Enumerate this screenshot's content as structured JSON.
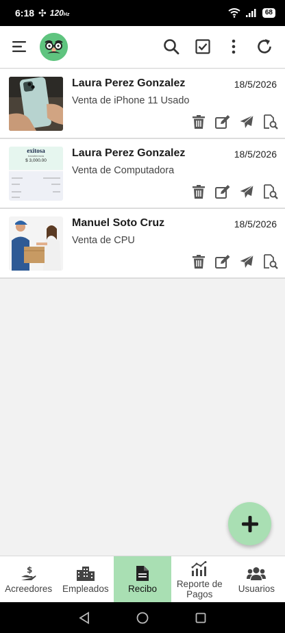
{
  "status_bar": {
    "time": "6:18",
    "refresh_rate": "120",
    "battery": "68"
  },
  "app_bar": {
    "icons": [
      "menu-icon",
      "avatar",
      "search-icon",
      "checkbox-icon",
      "more-vert-icon",
      "refresh-icon"
    ]
  },
  "receipts": [
    {
      "name": "Laura Perez Gonzalez",
      "date": "18/5/2026",
      "description": "Venta de iPhone 11 Usado",
      "thumb": "iphone-photo"
    },
    {
      "name": "Laura Perez Gonzalez",
      "date": "18/5/2026",
      "description": "Venta de Computadora",
      "thumb": "transfer-receipt",
      "thumb_text": {
        "brand": "exitosa",
        "sub": "transferencia",
        "amount": "$ 3,000.00"
      }
    },
    {
      "name": "Manuel Soto Cruz",
      "date": "18/5/2026",
      "description": "Venta de CPU",
      "thumb": "delivery-photo"
    }
  ],
  "bottom_nav": [
    {
      "label": "Acreedores",
      "icon": "hand-dollar-icon",
      "active": false
    },
    {
      "label": "Empleados",
      "icon": "buildings-icon",
      "active": false
    },
    {
      "label": "Recibo",
      "icon": "document-icon",
      "active": true
    },
    {
      "label": "Reporte de Pagos",
      "icon": "chart-icon",
      "active": false
    },
    {
      "label": "Usuarios",
      "icon": "users-icon",
      "active": false
    }
  ],
  "colors": {
    "accent": "#a9dfb3",
    "avatar_bg": "#5fc47f",
    "icon": "#555555"
  }
}
